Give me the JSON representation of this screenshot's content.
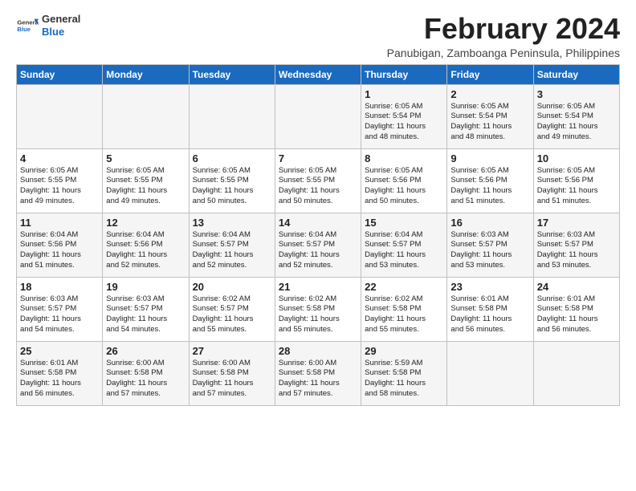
{
  "header": {
    "logo_general": "General",
    "logo_blue": "Blue",
    "title": "February 2024",
    "subtitle": "Panubigan, Zamboanga Peninsula, Philippines"
  },
  "days_of_week": [
    "Sunday",
    "Monday",
    "Tuesday",
    "Wednesday",
    "Thursday",
    "Friday",
    "Saturday"
  ],
  "weeks": [
    [
      {
        "day": "",
        "info": ""
      },
      {
        "day": "",
        "info": ""
      },
      {
        "day": "",
        "info": ""
      },
      {
        "day": "",
        "info": ""
      },
      {
        "day": "1",
        "info": "Sunrise: 6:05 AM\nSunset: 5:54 PM\nDaylight: 11 hours\nand 48 minutes."
      },
      {
        "day": "2",
        "info": "Sunrise: 6:05 AM\nSunset: 5:54 PM\nDaylight: 11 hours\nand 48 minutes."
      },
      {
        "day": "3",
        "info": "Sunrise: 6:05 AM\nSunset: 5:54 PM\nDaylight: 11 hours\nand 49 minutes."
      }
    ],
    [
      {
        "day": "4",
        "info": "Sunrise: 6:05 AM\nSunset: 5:55 PM\nDaylight: 11 hours\nand 49 minutes."
      },
      {
        "day": "5",
        "info": "Sunrise: 6:05 AM\nSunset: 5:55 PM\nDaylight: 11 hours\nand 49 minutes."
      },
      {
        "day": "6",
        "info": "Sunrise: 6:05 AM\nSunset: 5:55 PM\nDaylight: 11 hours\nand 50 minutes."
      },
      {
        "day": "7",
        "info": "Sunrise: 6:05 AM\nSunset: 5:55 PM\nDaylight: 11 hours\nand 50 minutes."
      },
      {
        "day": "8",
        "info": "Sunrise: 6:05 AM\nSunset: 5:56 PM\nDaylight: 11 hours\nand 50 minutes."
      },
      {
        "day": "9",
        "info": "Sunrise: 6:05 AM\nSunset: 5:56 PM\nDaylight: 11 hours\nand 51 minutes."
      },
      {
        "day": "10",
        "info": "Sunrise: 6:05 AM\nSunset: 5:56 PM\nDaylight: 11 hours\nand 51 minutes."
      }
    ],
    [
      {
        "day": "11",
        "info": "Sunrise: 6:04 AM\nSunset: 5:56 PM\nDaylight: 11 hours\nand 51 minutes."
      },
      {
        "day": "12",
        "info": "Sunrise: 6:04 AM\nSunset: 5:56 PM\nDaylight: 11 hours\nand 52 minutes."
      },
      {
        "day": "13",
        "info": "Sunrise: 6:04 AM\nSunset: 5:57 PM\nDaylight: 11 hours\nand 52 minutes."
      },
      {
        "day": "14",
        "info": "Sunrise: 6:04 AM\nSunset: 5:57 PM\nDaylight: 11 hours\nand 52 minutes."
      },
      {
        "day": "15",
        "info": "Sunrise: 6:04 AM\nSunset: 5:57 PM\nDaylight: 11 hours\nand 53 minutes."
      },
      {
        "day": "16",
        "info": "Sunrise: 6:03 AM\nSunset: 5:57 PM\nDaylight: 11 hours\nand 53 minutes."
      },
      {
        "day": "17",
        "info": "Sunrise: 6:03 AM\nSunset: 5:57 PM\nDaylight: 11 hours\nand 53 minutes."
      }
    ],
    [
      {
        "day": "18",
        "info": "Sunrise: 6:03 AM\nSunset: 5:57 PM\nDaylight: 11 hours\nand 54 minutes."
      },
      {
        "day": "19",
        "info": "Sunrise: 6:03 AM\nSunset: 5:57 PM\nDaylight: 11 hours\nand 54 minutes."
      },
      {
        "day": "20",
        "info": "Sunrise: 6:02 AM\nSunset: 5:57 PM\nDaylight: 11 hours\nand 55 minutes."
      },
      {
        "day": "21",
        "info": "Sunrise: 6:02 AM\nSunset: 5:58 PM\nDaylight: 11 hours\nand 55 minutes."
      },
      {
        "day": "22",
        "info": "Sunrise: 6:02 AM\nSunset: 5:58 PM\nDaylight: 11 hours\nand 55 minutes."
      },
      {
        "day": "23",
        "info": "Sunrise: 6:01 AM\nSunset: 5:58 PM\nDaylight: 11 hours\nand 56 minutes."
      },
      {
        "day": "24",
        "info": "Sunrise: 6:01 AM\nSunset: 5:58 PM\nDaylight: 11 hours\nand 56 minutes."
      }
    ],
    [
      {
        "day": "25",
        "info": "Sunrise: 6:01 AM\nSunset: 5:58 PM\nDaylight: 11 hours\nand 56 minutes."
      },
      {
        "day": "26",
        "info": "Sunrise: 6:00 AM\nSunset: 5:58 PM\nDaylight: 11 hours\nand 57 minutes."
      },
      {
        "day": "27",
        "info": "Sunrise: 6:00 AM\nSunset: 5:58 PM\nDaylight: 11 hours\nand 57 minutes."
      },
      {
        "day": "28",
        "info": "Sunrise: 6:00 AM\nSunset: 5:58 PM\nDaylight: 11 hours\nand 57 minutes."
      },
      {
        "day": "29",
        "info": "Sunrise: 5:59 AM\nSunset: 5:58 PM\nDaylight: 11 hours\nand 58 minutes."
      },
      {
        "day": "",
        "info": ""
      },
      {
        "day": "",
        "info": ""
      }
    ]
  ]
}
